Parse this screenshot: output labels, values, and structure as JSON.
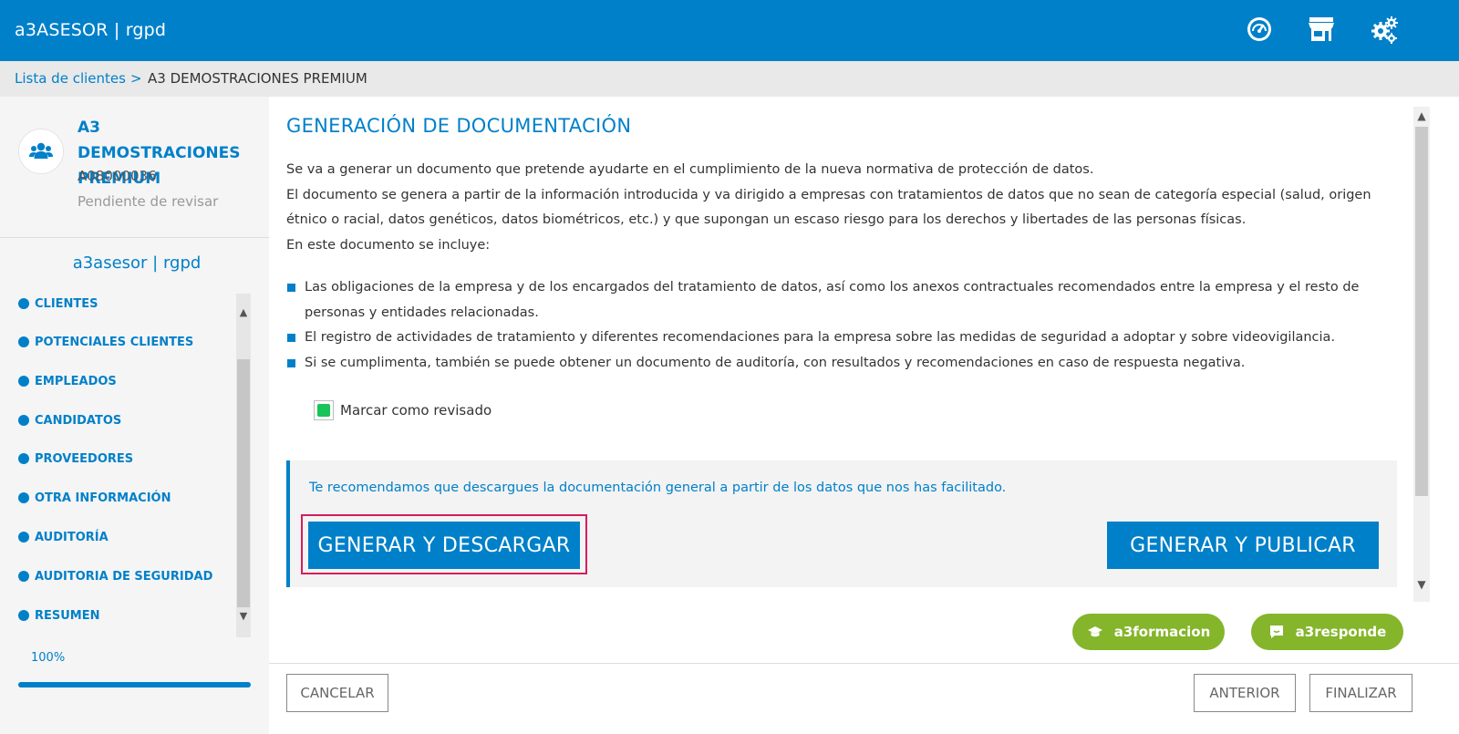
{
  "header": {
    "brand": "a3ASESOR | rgpd",
    "icons": [
      "dashboard-gauge-icon",
      "store-icon",
      "settings-gears-icon"
    ],
    "color": "#0080c9"
  },
  "breadcrumb": {
    "link": "Lista de clientes",
    "separator": ">",
    "current": "A3 DEMOSTRACIONES PREMIUM"
  },
  "client": {
    "name": "A3 DEMOSTRACIONES PREMIUM",
    "id": "A08000036",
    "status": "Pendiente de revisar",
    "icon": "users-group-icon"
  },
  "sidebar": {
    "app_title": "a3asesor | rgpd",
    "items": [
      {
        "label": "CLIENTES"
      },
      {
        "label": "POTENCIALES CLIENTES"
      },
      {
        "label": "EMPLEADOS"
      },
      {
        "label": "CANDIDATOS"
      },
      {
        "label": "PROVEEDORES"
      },
      {
        "label": "OTRA INFORMACIÓN"
      },
      {
        "label": "AUDITORÍA"
      },
      {
        "label": "AUDITORIA DE SEGURIDAD"
      },
      {
        "label": "RESUMEN"
      }
    ],
    "progress_label": "100%",
    "progress_value": 1.0
  },
  "main": {
    "title": "GENERACIÓN DE DOCUMENTACIÓN",
    "paragraphs": [
      "Se va a generar un documento que pretende ayudarte en el cumplimiento de la nueva normativa de protección de datos.",
      "El documento se genera a partir de la información introducida y va dirigido a empresas con tratamientos de datos que no sean de categoría especial (salud, origen étnico o racial, datos genéticos, datos biométricos, etc.) y que supongan un escaso riesgo para los derechos y libertades de las personas físicas.",
      "En este documento se incluye:"
    ],
    "bullets": [
      "Las obligaciones de la empresa y de los encargados del tratamiento de datos, así como los anexos contractuales recomendados entre la empresa y el resto de personas y entidades relacionadas.",
      "El registro de actividades de tratamiento y diferentes recomendaciones para la empresa sobre las medidas de seguridad a adoptar y sobre videovigilancia.",
      "Si se cumplimenta, también se puede obtener un documento de auditoría, con resultados y recomendaciones en caso de respuesta negativa."
    ],
    "checkbox_label": "Marcar como revisado",
    "checkbox_checked": true,
    "panel_text": "Te recomendamos que descargues la documentación general a partir de los datos que nos has facilitado.",
    "btn_download": "GENERAR Y DESCARGAR",
    "btn_publish": "GENERAR Y PUBLICAR"
  },
  "help": {
    "formacion": "a3formacion",
    "responde": "a3responde",
    "color": "#84b52a"
  },
  "footer": {
    "cancel": "CANCELAR",
    "previous": "ANTERIOR",
    "finish": "FINALIZAR"
  }
}
